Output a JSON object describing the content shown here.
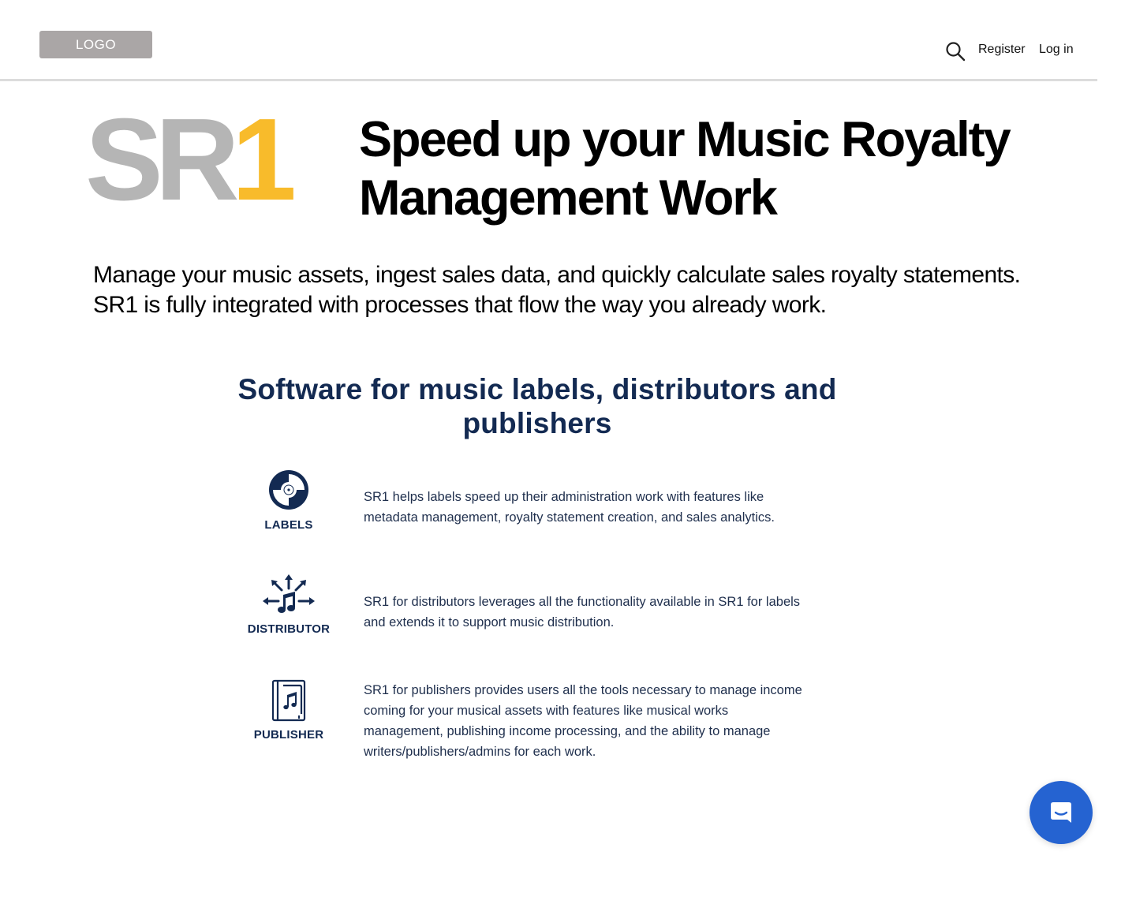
{
  "header": {
    "logo_label": "LOGO",
    "nav": {
      "register_label": "Register",
      "login_label": "Log in"
    }
  },
  "hero": {
    "brand_letters": "SR",
    "brand_number": "1",
    "title": "Speed up your Music Royalty Management Work",
    "subtitle": "Manage your music assets, ingest sales data, and quickly calculate sales royalty statements. SR1 is fully integrated with processes that flow the way you already work."
  },
  "features": {
    "title": "Software for music labels, distributors and publishers",
    "items": [
      {
        "label": "LABELS",
        "icon": "vinyl-record-icon",
        "text": "SR1 helps labels speed up their administration work with features like metadata management, royalty statement creation, and sales analytics."
      },
      {
        "label": "DISTRIBUTOR",
        "icon": "music-distribution-icon",
        "text": "SR1 for distributors leverages all the functionality available in SR1 for labels and extends it to support music distribution."
      },
      {
        "label": "PUBLISHER",
        "icon": "music-book-icon",
        "text": "SR1 for publishers provides users all the tools necessary to manage income coming for your musical assets with features like musical works management, publishing income processing, and the ability to manage writers/publishers/admins for each work."
      }
    ]
  },
  "chat": {
    "icon": "chat-bubble-icon"
  },
  "colors": {
    "brand_gray": "#b5b5b5",
    "brand_yellow": "#f8bb2b",
    "navy": "#132a52",
    "chat_blue": "#2563d1",
    "logo_placeholder": "#aaa6a6"
  }
}
